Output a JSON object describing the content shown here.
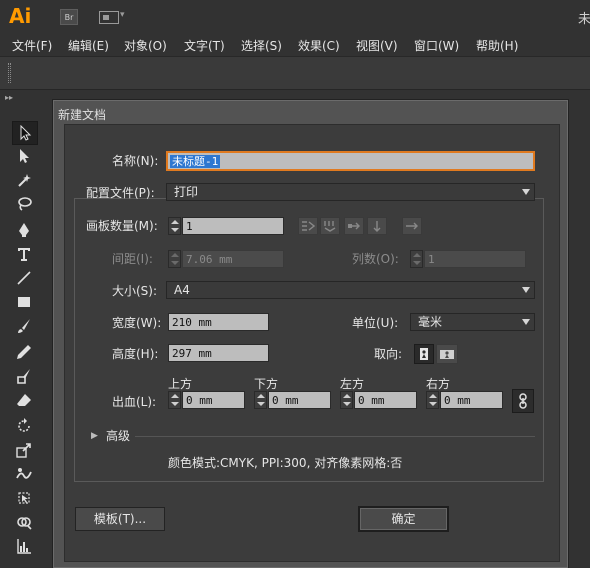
{
  "app": {
    "logo": "Ai",
    "bridge_button": "Br",
    "corner_text": "未"
  },
  "menu": [
    "文件(F)",
    "编辑(E)",
    "对象(O)",
    "文字(T)",
    "选择(S)",
    "效果(C)",
    "视图(V)",
    "窗口(W)",
    "帮助(H)"
  ],
  "toolbar": {
    "header": "▸▸",
    "tools": [
      "selection-tool",
      "direct-selection-tool",
      "magic-wand-tool",
      "lasso-tool",
      "pen-tool",
      "type-tool",
      "line-tool",
      "rectangle-tool",
      "paintbrush-tool",
      "pencil-tool",
      "blob-brush-tool",
      "eraser-tool",
      "rotate-tool",
      "scale-tool",
      "warp-tool",
      "free-transform-tool",
      "shape-builder-tool",
      "graph-tool"
    ]
  },
  "dialog": {
    "title": "新建文档",
    "name_label": "名称(N):",
    "name_value": "未标题-1",
    "profile_label": "配置文件(P):",
    "profile_value": "打印",
    "artboards_label": "画板数量(M):",
    "artboards_value": "1",
    "spacing_label": "间距(I):",
    "spacing_value": "7.06 mm",
    "columns_label": "列数(O):",
    "columns_value": "1",
    "size_label": "大小(S):",
    "size_value": "A4",
    "width_label": "宽度(W):",
    "width_value": "210 mm",
    "units_label": "单位(U):",
    "units_value": "毫米",
    "height_label": "高度(H):",
    "height_value": "297 mm",
    "orientation_label": "取向:",
    "bleed_label": "出血(L):",
    "bleed": {
      "top_label": "上方",
      "top_value": "0 mm",
      "bottom_label": "下方",
      "bottom_value": "0 mm",
      "left_label": "左方",
      "left_value": "0 mm",
      "right_label": "右方",
      "right_value": "0 mm"
    },
    "advanced_label": "高级",
    "info_text": "颜色模式:CMYK, PPI:300, 对齐像素网格:否",
    "templates_button": "模板(T)...",
    "ok_button": "确定"
  },
  "colors": {
    "accent": "#ff9a00",
    "selection": "#2e77d0",
    "focus": "#e07a1f"
  }
}
